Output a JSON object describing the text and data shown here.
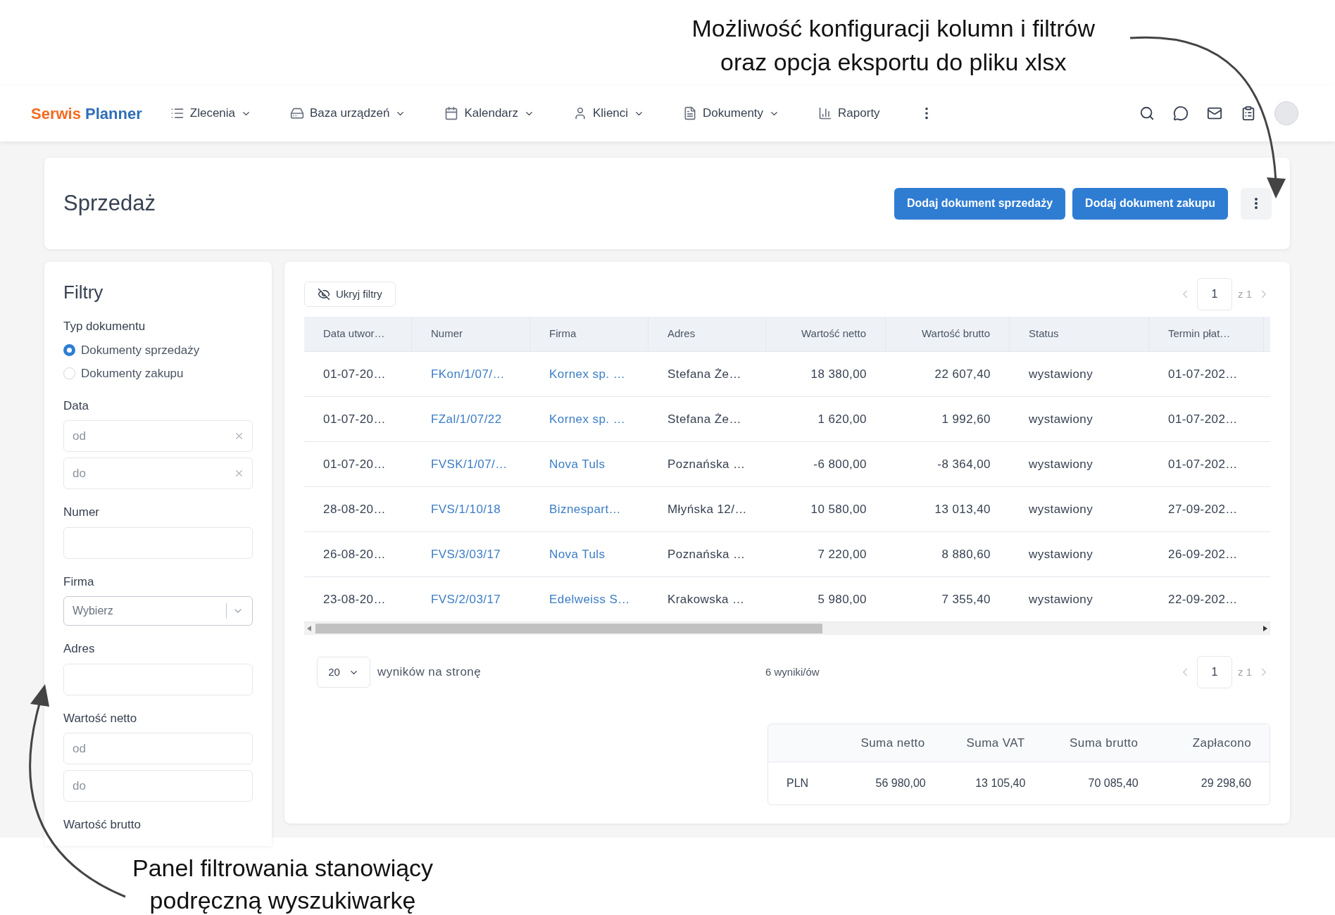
{
  "annotations": [
    {
      "lines": [
        "Możliwość konfiguracji kolumn i filtrów",
        "oraz opcja eksportu do pliku xlsx"
      ]
    },
    {
      "lines": [
        "Panel filtrowania stanowiący",
        "podręczną wyszukiwarkę"
      ]
    }
  ],
  "navbar": {
    "logo": [
      "Serwis",
      "Planner"
    ],
    "items": [
      {
        "label": "Zlecenia",
        "kind": "dropdown"
      },
      {
        "label": "Baza urządzeń",
        "kind": "dropdown"
      },
      {
        "label": "Kalendarz",
        "kind": "dropdown"
      },
      {
        "label": "Klienci",
        "kind": "dropdown"
      },
      {
        "label": "Dokumenty",
        "kind": "dropdown"
      },
      {
        "label": "Raporty",
        "kind": "link"
      }
    ]
  },
  "header": {
    "title": "Sprzedaż",
    "buttons": [
      "Dodaj dokument sprzedaży",
      "Dodaj dokument zakupu"
    ]
  },
  "filters": {
    "title": "Filtry",
    "groups": [
      {
        "kind": "radio",
        "label": "Typ dokumentu",
        "options": [
          {
            "label": "Dokumenty sprzedaży",
            "selected": true
          },
          {
            "label": "Dokumenty zakupu",
            "selected": false
          }
        ]
      },
      {
        "kind": "range",
        "label": "Data",
        "clearable": true,
        "fields": [
          {
            "placeholder": "od"
          },
          {
            "placeholder": "do"
          }
        ]
      },
      {
        "kind": "text",
        "label": "Numer"
      },
      {
        "kind": "select",
        "label": "Firma",
        "placeholder": "Wybierz"
      },
      {
        "kind": "text",
        "label": "Adres"
      },
      {
        "kind": "range",
        "label": "Wartość netto",
        "clearable": false,
        "fields": [
          {
            "placeholder": "od"
          },
          {
            "placeholder": "do"
          }
        ]
      },
      {
        "kind": "heading",
        "label": "Wartość brutto"
      }
    ]
  },
  "toolbar": {
    "hide_filters": "Ukryj filtry",
    "pager": {
      "page": "1",
      "of": "z 1"
    }
  },
  "table": {
    "columns": [
      {
        "label": "Data utwor…",
        "kind": "text"
      },
      {
        "label": "Numer",
        "kind": "link"
      },
      {
        "label": "Firma",
        "kind": "link"
      },
      {
        "label": "Adres",
        "kind": "text"
      },
      {
        "label": "Wartość netto",
        "kind": "number"
      },
      {
        "label": "Wartość brutto",
        "kind": "number"
      },
      {
        "label": "Status",
        "kind": "text"
      },
      {
        "label": "Termin płat…",
        "kind": "text"
      }
    ],
    "rows": [
      {
        "cells": [
          "01-07-20…",
          "FKon/1/07/…",
          "Kornex sp. …",
          "Stefana Że…",
          "18 380,00",
          "22 607,40",
          "wystawiony",
          "01-07-202…"
        ]
      },
      {
        "cells": [
          "01-07-20…",
          "FZal/1/07/22",
          "Kornex sp. …",
          "Stefana Że…",
          "1 620,00",
          "1 992,60",
          "wystawiony",
          "01-07-202…"
        ]
      },
      {
        "cells": [
          "01-07-20…",
          "FVSK/1/07/…",
          "Nova Tuls",
          "Poznańska …",
          "-6 800,00",
          "-8 364,00",
          "wystawiony",
          "01-07-202…"
        ]
      },
      {
        "cells": [
          "28-08-20…",
          "FVS/1/10/18",
          "Biznespart…",
          "Młyńska 12/…",
          "10 580,00",
          "13 013,40",
          "wystawiony",
          "27-09-202…"
        ]
      },
      {
        "cells": [
          "26-08-20…",
          "FVS/3/03/17",
          "Nova Tuls",
          "Poznańska …",
          "7 220,00",
          "8 880,60",
          "wystawiony",
          "26-09-202…"
        ]
      },
      {
        "cells": [
          "23-08-20…",
          "FVS/2/03/17",
          "Edelweiss S…",
          "Krakowska …",
          "5 980,00",
          "7 355,40",
          "wystawiony",
          "22-09-202…"
        ]
      }
    ]
  },
  "footer": {
    "page_size": "20",
    "page_size_label": "wyników na stronę",
    "count": "6 wyniki/ów",
    "pager": {
      "page": "1",
      "of": "z 1"
    }
  },
  "totals": {
    "columns": [
      "Suma netto",
      "Suma VAT",
      "Suma brutto",
      "Zapłacono"
    ],
    "rows": [
      {
        "currency": "PLN",
        "values": [
          "56 980,00",
          "13 105,40",
          "70 085,40",
          "29 298,60"
        ]
      }
    ]
  }
}
